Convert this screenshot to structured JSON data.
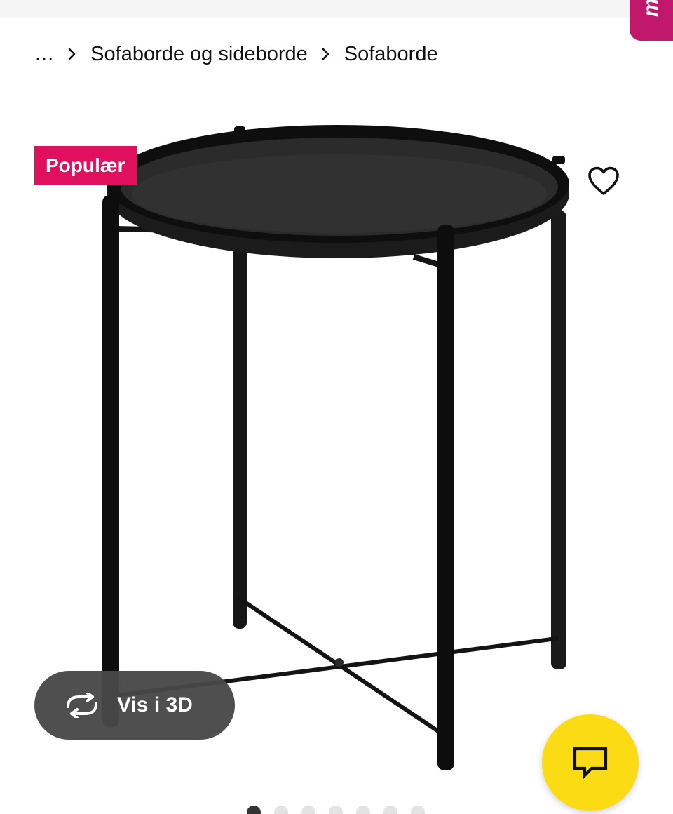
{
  "side_tab": {
    "text": "m",
    "color": "#c2186b"
  },
  "breadcrumb": {
    "ellipsis": "...",
    "separator_icon": "chevron-right-icon",
    "items": [
      "Sofaborde og sideborde",
      "Sofaborde"
    ]
  },
  "product": {
    "badge": "Populær",
    "badge_color": "#e0105e",
    "image": "black round tray table with four legs and cross brace",
    "favorite_icon": "heart-outline-icon"
  },
  "view_3d": {
    "label": "Vis i 3D",
    "icon": "rotate-3d-icon"
  },
  "chat": {
    "icon": "chat-bubble-icon",
    "color": "#fadb14"
  },
  "carousel": {
    "total": 7,
    "active_index": 0
  }
}
